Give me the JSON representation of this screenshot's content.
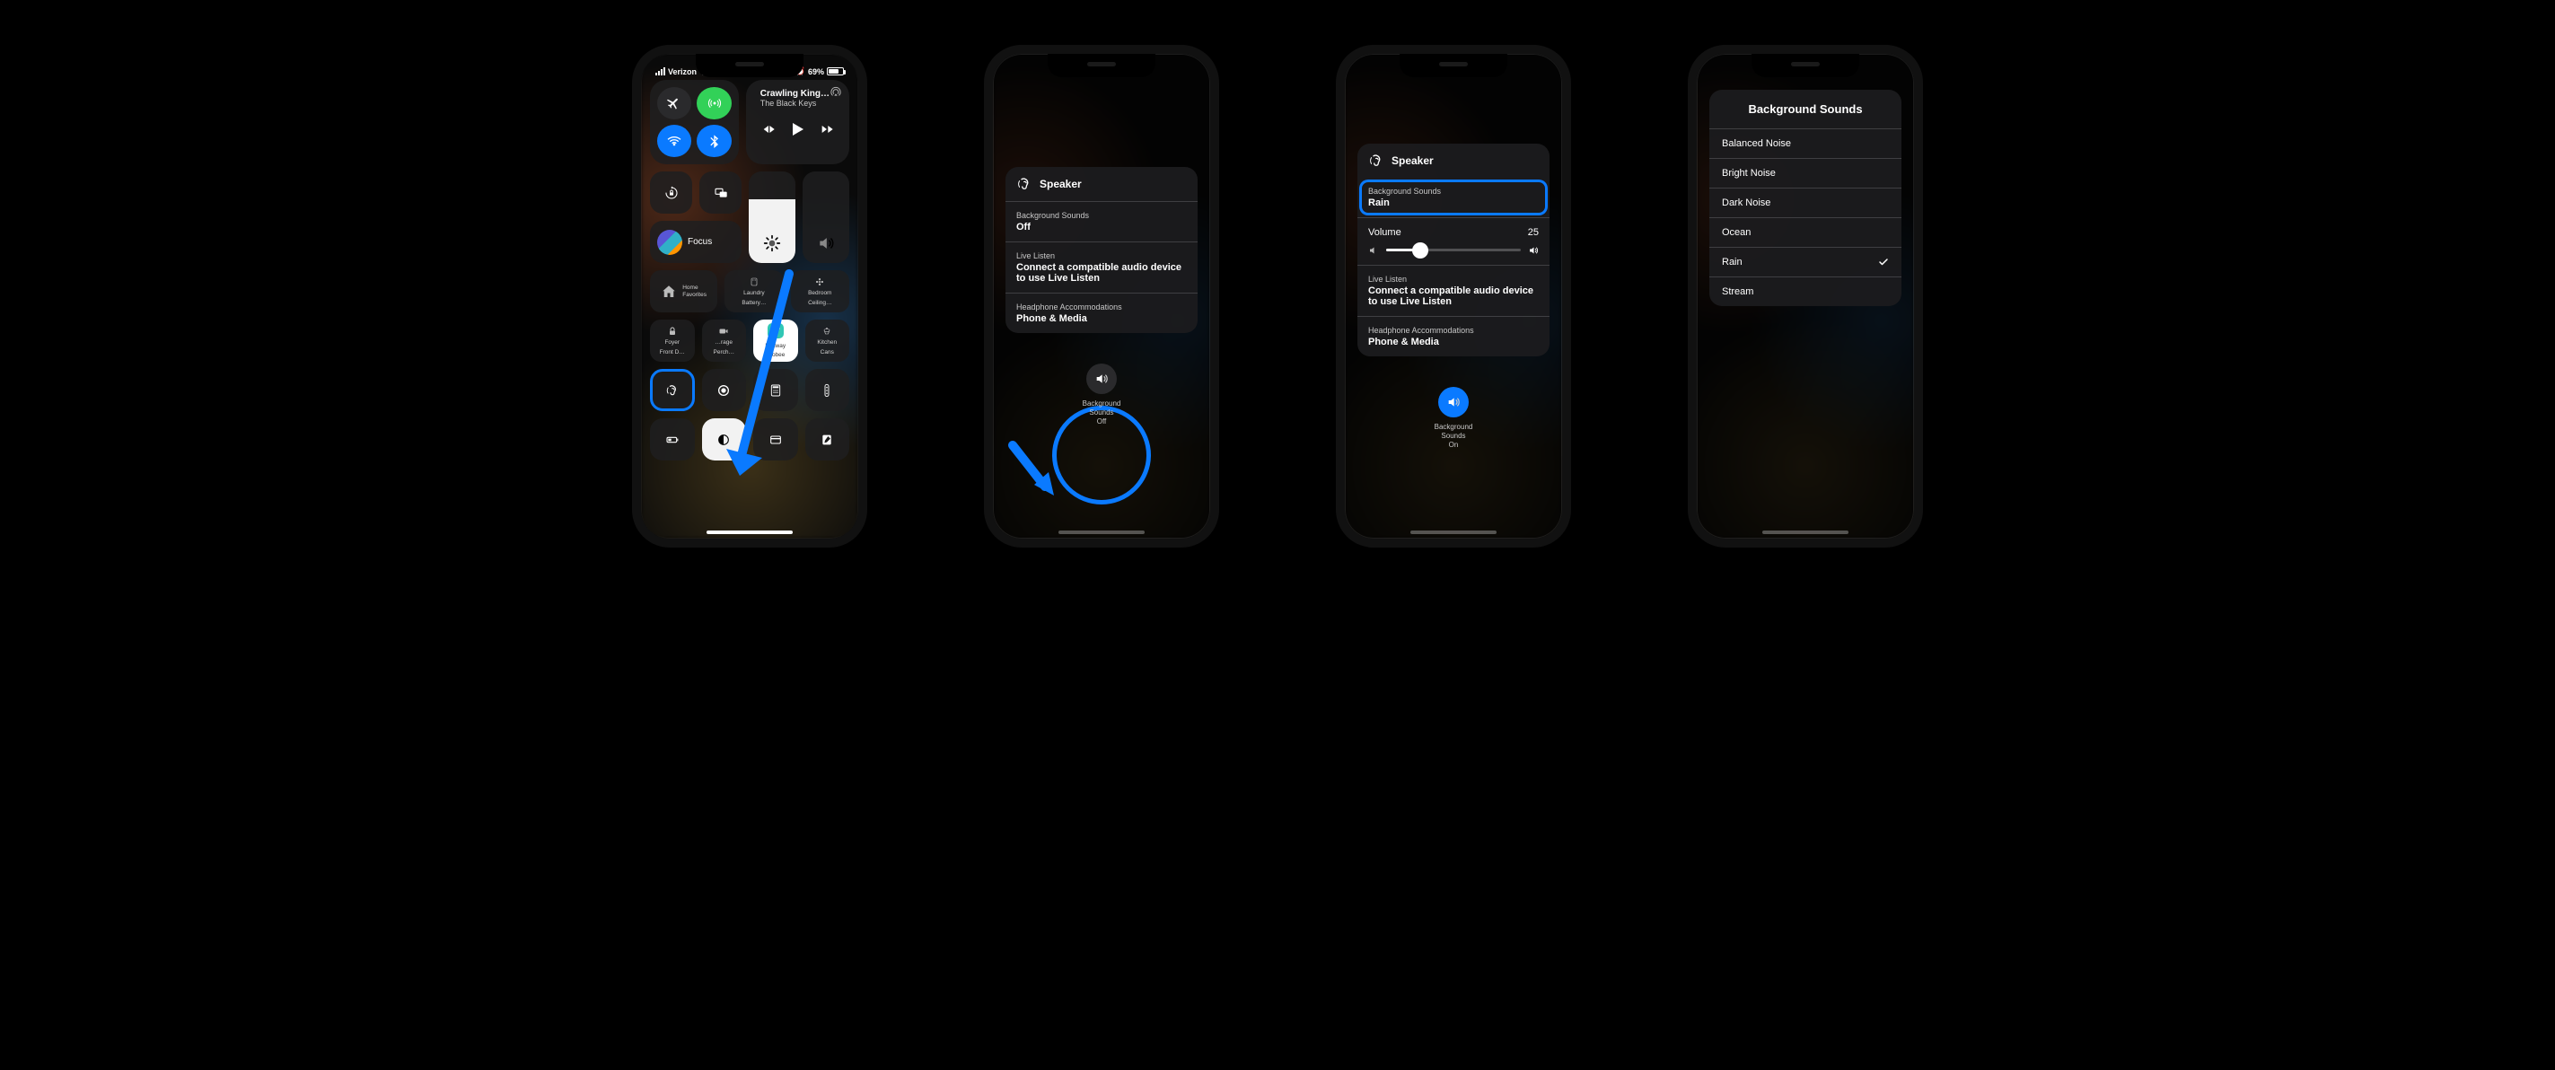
{
  "phone1": {
    "status": {
      "carrier": "Verizon",
      "battery_pct": "69%"
    },
    "media": {
      "title": "Crawling King…",
      "artist": "The Black Keys"
    },
    "focus_label": "Focus",
    "tiles": {
      "home": {
        "line1": "Home",
        "line2": "Favorites"
      },
      "laundry": {
        "line1": "Laundry",
        "line2": "Battery…"
      },
      "bedroom": {
        "line1": "Bedroom",
        "line2": "Ceiling…"
      },
      "foyer": {
        "line1": "Foyer",
        "line2": "Front D…"
      },
      "garage": {
        "line1": "…rage",
        "line2": "Perch…"
      },
      "ecobee": {
        "badge": "74°",
        "line1": "Hallway",
        "line2": "ecobee"
      },
      "kitchen": {
        "line1": "Kitchen",
        "line2": "Cans"
      }
    }
  },
  "phone2": {
    "speaker": "Speaker",
    "bs_label": "Background Sounds",
    "bs_state": "Off",
    "ll_label": "Live Listen",
    "ll_msg": "Connect a compatible audio device to use Live Listen",
    "ha_label": "Headphone Accommodations",
    "ha_val": "Phone & Media",
    "btn_label": "Background\nSounds",
    "btn_state": "Off"
  },
  "phone3": {
    "speaker": "Speaker",
    "bs_label": "Background Sounds",
    "bs_state": "Rain",
    "vol_label": "Volume",
    "vol_value": "25",
    "ll_label": "Live Listen",
    "ll_msg": "Connect a compatible audio device to use Live Listen",
    "ha_label": "Headphone Accommodations",
    "ha_val": "Phone & Media",
    "btn_label": "Background\nSounds",
    "btn_state": "On"
  },
  "phone4": {
    "header": "Background Sounds",
    "options": [
      "Balanced Noise",
      "Bright Noise",
      "Dark Noise",
      "Ocean",
      "Rain",
      "Stream"
    ],
    "selected_idx": 4
  }
}
